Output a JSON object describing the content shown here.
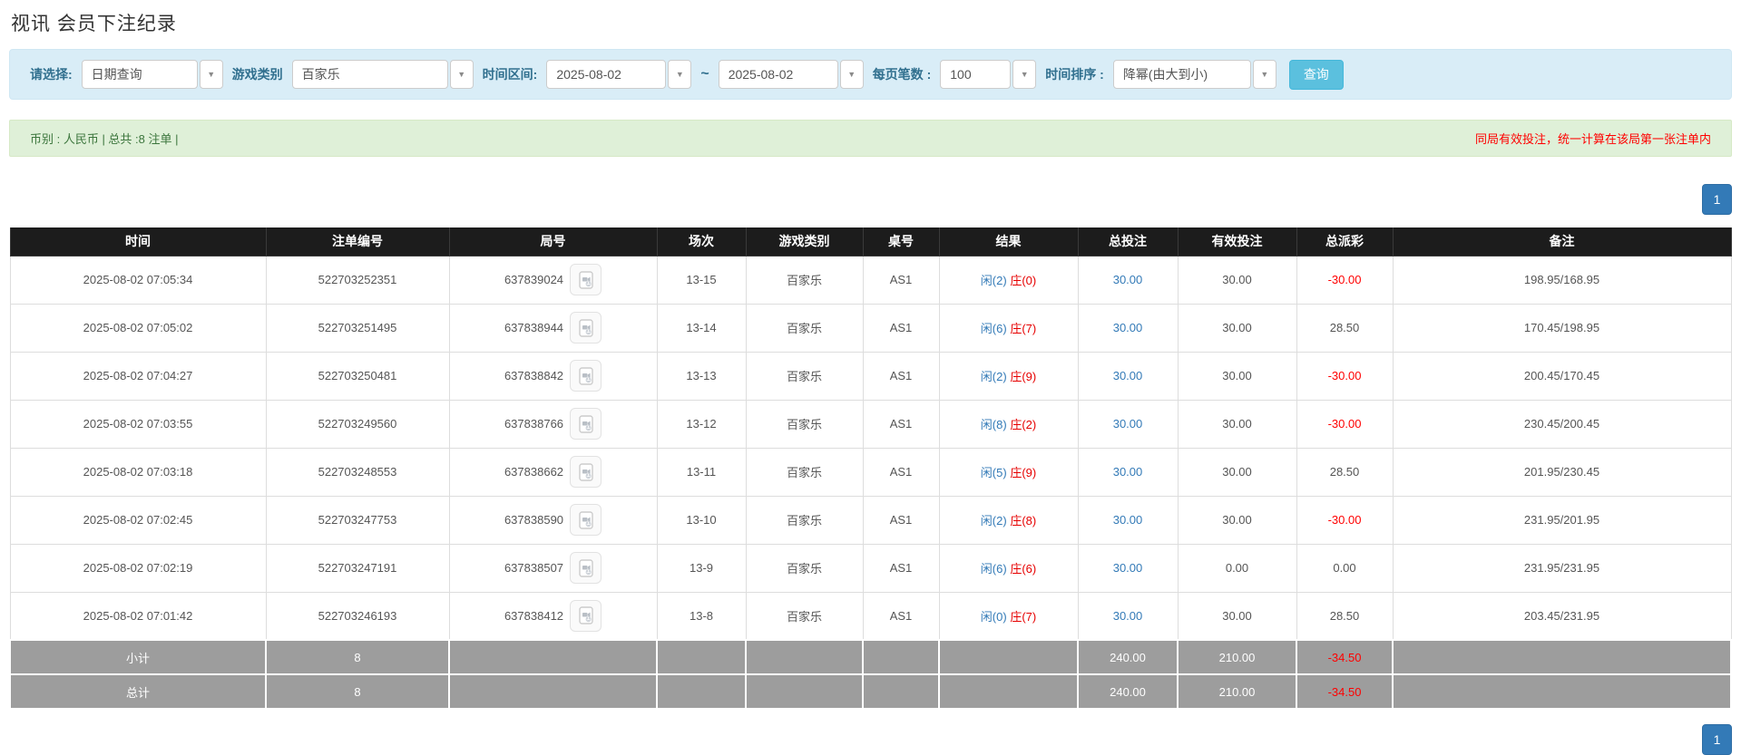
{
  "title": "视讯 会员下注纪录",
  "filter": {
    "select_label": "请选择:",
    "select_value": "日期查询",
    "game_label": "游戏类别",
    "game_value": "百家乐",
    "range_label": "时间区间:",
    "date_from": "2025-08-02",
    "tilde": "~",
    "date_to": "2025-08-02",
    "per_page_label": "每页笔数 :",
    "per_page_value": "100",
    "sort_label": "时间排序 :",
    "sort_value": "降幂(由大到小)",
    "search_button": "查询"
  },
  "summary": {
    "left": "币别 : 人民币 | 总共 :8 注单 |",
    "right": "同局有效投注，统一计算在该局第一张注单内"
  },
  "pagination": {
    "page": "1"
  },
  "colors": {
    "accent": "#5bc0de",
    "link_blue": "#337ab7",
    "banker_red": "#e60000",
    "negative_red": "#ff0000",
    "header_bg": "#1c1c1c",
    "summary_bg": "#dff0d8",
    "filter_bg": "#d9edf7",
    "totals_bg": "#9d9d9d"
  },
  "table": {
    "headers": [
      "时间",
      "注单编号",
      "局号",
      "场次",
      "游戏类别",
      "桌号",
      "结果",
      "总投注",
      "有效投注",
      "总派彩",
      "备注"
    ],
    "video_icon": "video-icon",
    "rows": [
      {
        "time": "2025-08-02 07:05:34",
        "bet_no": "522703252351",
        "round_no": "637839024",
        "session": "13-15",
        "game": "百家乐",
        "table_no": "AS1",
        "result_player": "闲(2)",
        "result_banker": "庄(0)",
        "total_bet": "30.00",
        "valid_bet": "30.00",
        "payout": "-30.00",
        "remark": "198.95/168.95"
      },
      {
        "time": "2025-08-02 07:05:02",
        "bet_no": "522703251495",
        "round_no": "637838944",
        "session": "13-14",
        "game": "百家乐",
        "table_no": "AS1",
        "result_player": "闲(6)",
        "result_banker": "庄(7)",
        "total_bet": "30.00",
        "valid_bet": "30.00",
        "payout": "28.50",
        "remark": "170.45/198.95"
      },
      {
        "time": "2025-08-02 07:04:27",
        "bet_no": "522703250481",
        "round_no": "637838842",
        "session": "13-13",
        "game": "百家乐",
        "table_no": "AS1",
        "result_player": "闲(2)",
        "result_banker": "庄(9)",
        "total_bet": "30.00",
        "valid_bet": "30.00",
        "payout": "-30.00",
        "remark": "200.45/170.45"
      },
      {
        "time": "2025-08-02 07:03:55",
        "bet_no": "522703249560",
        "round_no": "637838766",
        "session": "13-12",
        "game": "百家乐",
        "table_no": "AS1",
        "result_player": "闲(8)",
        "result_banker": "庄(2)",
        "total_bet": "30.00",
        "valid_bet": "30.00",
        "payout": "-30.00",
        "remark": "230.45/200.45"
      },
      {
        "time": "2025-08-02 07:03:18",
        "bet_no": "522703248553",
        "round_no": "637838662",
        "session": "13-11",
        "game": "百家乐",
        "table_no": "AS1",
        "result_player": "闲(5)",
        "result_banker": "庄(9)",
        "total_bet": "30.00",
        "valid_bet": "30.00",
        "payout": "28.50",
        "remark": "201.95/230.45"
      },
      {
        "time": "2025-08-02 07:02:45",
        "bet_no": "522703247753",
        "round_no": "637838590",
        "session": "13-10",
        "game": "百家乐",
        "table_no": "AS1",
        "result_player": "闲(2)",
        "result_banker": "庄(8)",
        "total_bet": "30.00",
        "valid_bet": "30.00",
        "payout": "-30.00",
        "remark": "231.95/201.95"
      },
      {
        "time": "2025-08-02 07:02:19",
        "bet_no": "522703247191",
        "round_no": "637838507",
        "session": "13-9",
        "game": "百家乐",
        "table_no": "AS1",
        "result_player": "闲(6)",
        "result_banker": "庄(6)",
        "total_bet": "30.00",
        "valid_bet": "0.00",
        "payout": "0.00",
        "remark": "231.95/231.95"
      },
      {
        "time": "2025-08-02 07:01:42",
        "bet_no": "522703246193",
        "round_no": "637838412",
        "session": "13-8",
        "game": "百家乐",
        "table_no": "AS1",
        "result_player": "闲(0)",
        "result_banker": "庄(7)",
        "total_bet": "30.00",
        "valid_bet": "30.00",
        "payout": "28.50",
        "remark": "203.45/231.95"
      }
    ],
    "subtotal": {
      "label": "小计",
      "count": "8",
      "total_bet": "240.00",
      "valid_bet": "210.00",
      "payout": "-34.50"
    },
    "total": {
      "label": "总计",
      "count": "8",
      "total_bet": "240.00",
      "valid_bet": "210.00",
      "payout": "-34.50"
    }
  }
}
